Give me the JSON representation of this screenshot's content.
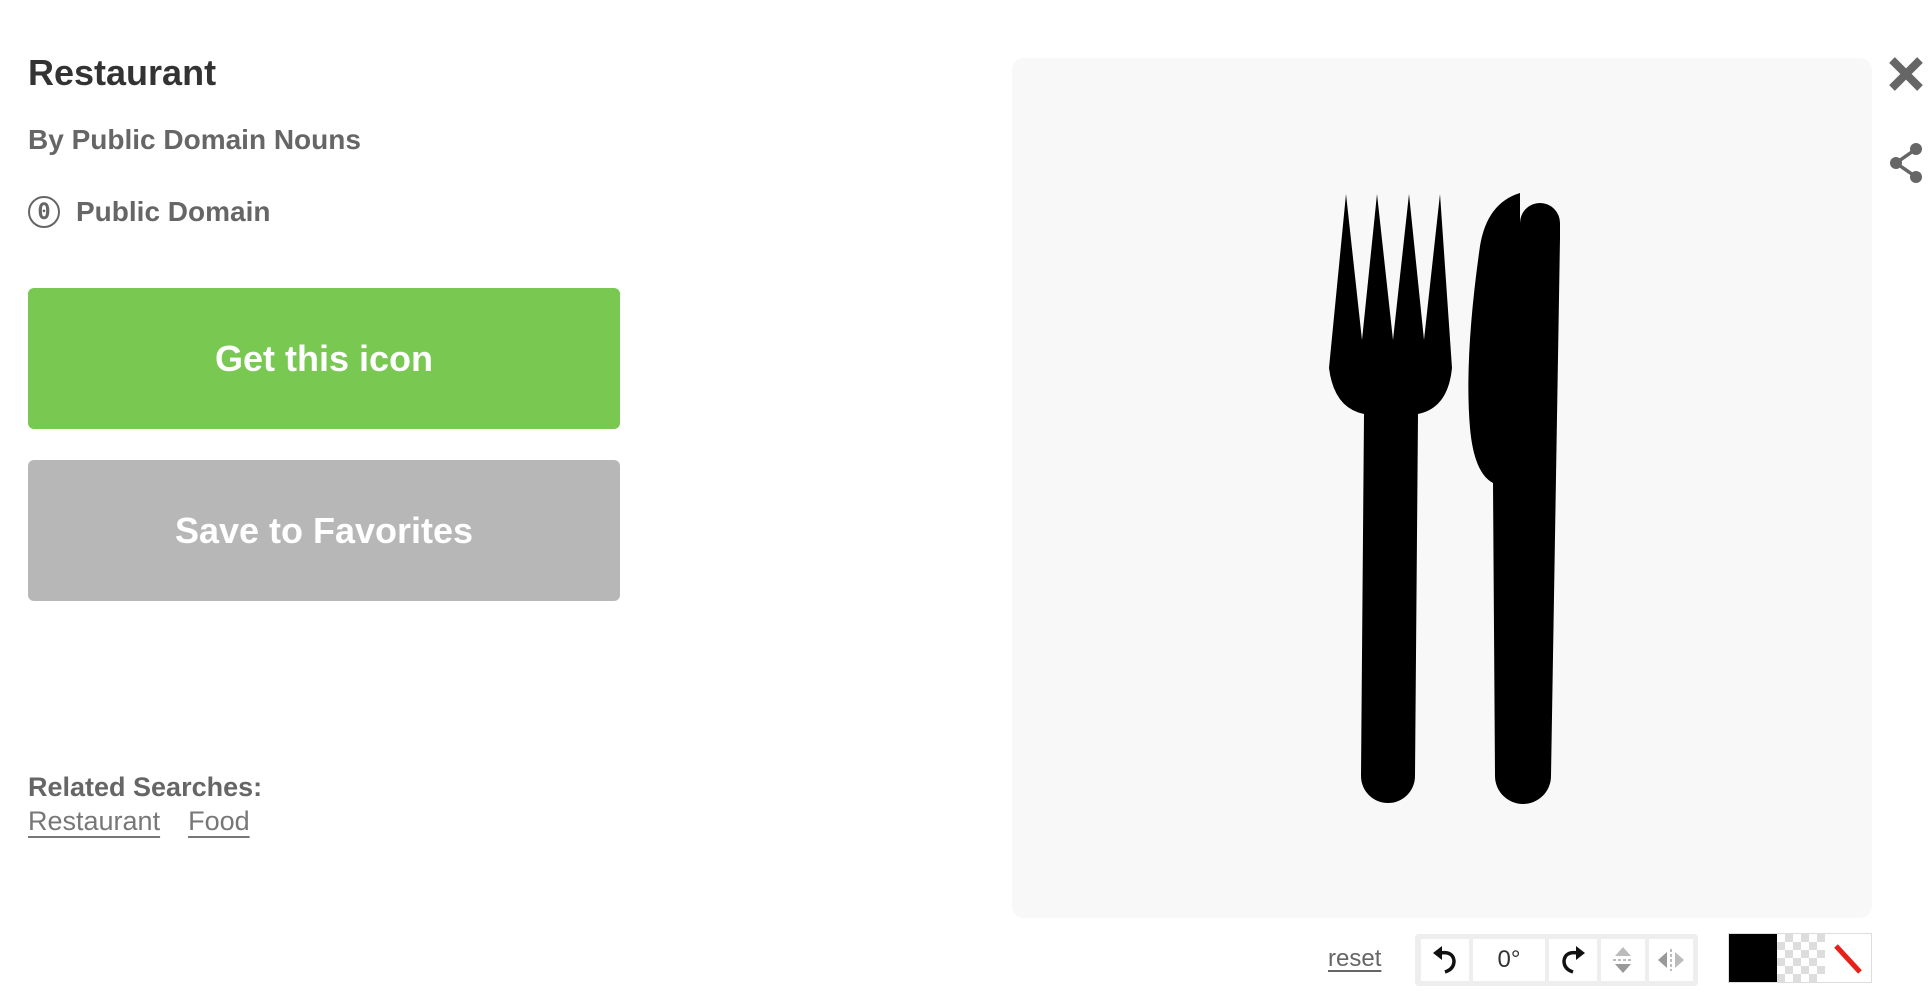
{
  "icon": {
    "title": "Restaurant",
    "author": "By Public Domain Nouns",
    "license": {
      "symbol": "0",
      "label": "Public Domain"
    }
  },
  "actions": {
    "get_label": "Get this icon",
    "favorite_label": "Save to Favorites"
  },
  "related": {
    "heading": "Related Searches:",
    "links": [
      "Restaurant",
      "Food"
    ]
  },
  "editor": {
    "reset_label": "reset",
    "rotation": "0°",
    "icons": [
      "rotate-left-icon",
      "rotate-right-icon",
      "flip-vertical-icon",
      "flip-horizontal-icon",
      "close-icon",
      "share-icon"
    ]
  },
  "colors": {
    "primary_button": "#78c852",
    "secondary_button": "#b7b7b7",
    "preview_background": "#f8f8f8",
    "icon_fill": "#000000",
    "no_color_slash": "#e8201a"
  }
}
